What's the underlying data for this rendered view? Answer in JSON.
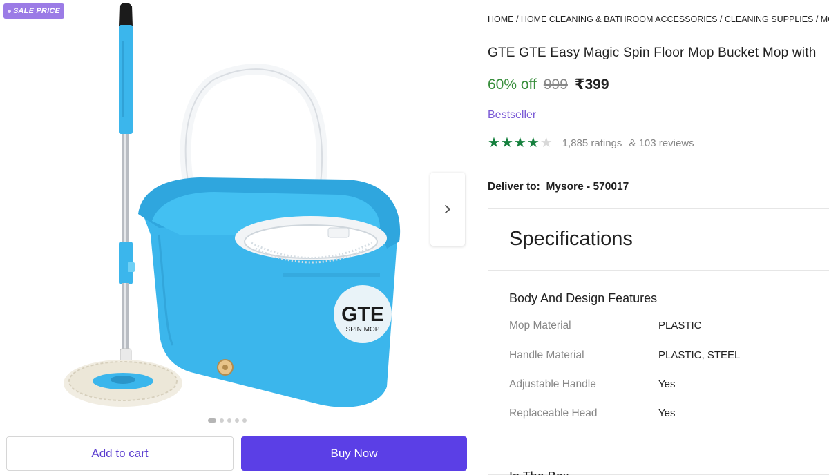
{
  "gallery": {
    "badge": "SALE PRICE",
    "image_logo_line1": "GTE",
    "image_logo_line2": "SPIN MOP",
    "dots_count": 5,
    "active_dot": 0
  },
  "actions": {
    "add_to_cart": "Add to cart",
    "buy_now": "Buy Now"
  },
  "product": {
    "breadcrumb": "HOME / HOME CLEANING & BATHROOM ACCESSORIES / CLEANING SUPPLIES / MOP",
    "title": "GTE GTE Easy Magic Spin Floor Mop Bucket Mop with",
    "discount": "60% off",
    "mrp": "999",
    "price": "₹399",
    "tag": "Bestseller",
    "rating_stars": 4,
    "rating_max": 5,
    "ratings_text": "1,885 ratings",
    "reviews_text": "& 103 reviews",
    "deliver_label": "Deliver to:",
    "deliver_location": "Mysore - 570017"
  },
  "specifications": {
    "heading": "Specifications",
    "group_title": "Body And Design Features",
    "rows": [
      {
        "key": "Mop Material",
        "value": "PLASTIC"
      },
      {
        "key": "Handle Material",
        "value": "PLASTIC, STEEL"
      },
      {
        "key": "Adjustable Handle",
        "value": "Yes"
      },
      {
        "key": "Replaceable Head",
        "value": "Yes"
      }
    ],
    "next_group_title": "In The Box"
  },
  "colors": {
    "brand_purple": "#5b3fe6",
    "discount_green": "#388e3c",
    "star_green": "#15803d",
    "badge_purple": "#9b7be6",
    "bucket_blue": "#3bb6ec"
  }
}
